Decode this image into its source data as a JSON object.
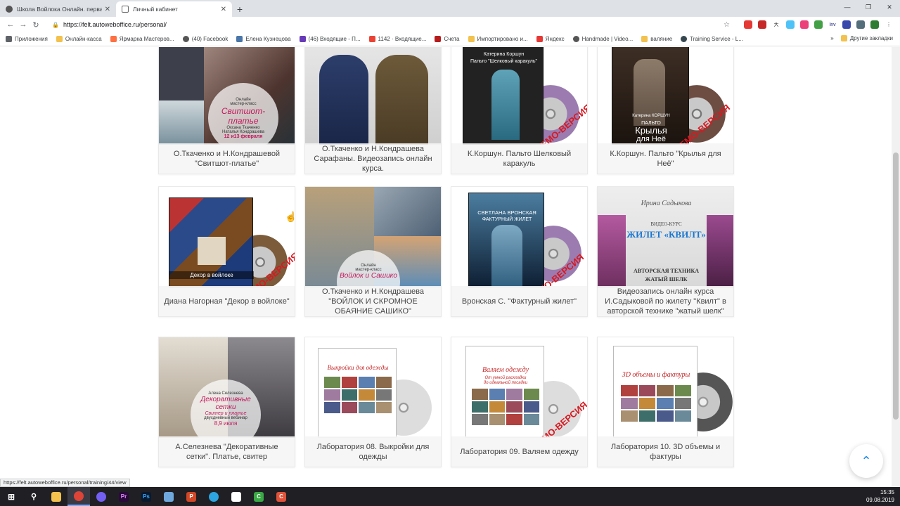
{
  "browser": {
    "tabs": [
      {
        "title": "Школа Войлока Онлайн. первая",
        "active": false
      },
      {
        "title": "Личный кабинет",
        "active": true
      }
    ],
    "url": "https://felt.autoweboffice.ru/personal/",
    "bookmarks": [
      "Приложения",
      "Онлайн-касса",
      "Ярмарка Мастеров...",
      "(40) Facebook",
      "Елена Кузнецова",
      "(46) Входящие - П...",
      "1142 · Входящие...",
      "Счета",
      "Импортировано и...",
      "Яндекс",
      "Handmade | Video...",
      "валяние",
      "Training Service - L..."
    ],
    "other_bookmarks": "Другие закладки"
  },
  "cards": [
    {
      "caption": "О.Ткаченко и Н.Кондрашевой \"Свитшот-платье\"",
      "badge": [
        "Онлайн",
        "мастер-класс",
        "Свитшот-",
        "платье",
        "Оксана Ткаченко",
        "Наталья Кондрашева",
        "12 и13 февраля"
      ]
    },
    {
      "caption": "О.Ткаченко и Н.Кондрашева Сарафаны. Видеозапись онлайн курса."
    },
    {
      "caption": "К.Коршун. Пальто Шелковый каракуль",
      "dvd": [
        "Катерина Коршун",
        "Пальто \"Шелковый каракуль\""
      ],
      "ribbon": "ДЕМО-ВЕРСИЯ"
    },
    {
      "caption": "К.Коршун. Пальто \"Крылья для Неё\"",
      "dvd": [
        "Катерина КОРШУН",
        "ПАЛЬТО",
        "Крылья",
        "для Неё"
      ],
      "ribbon": "ДЕМО-ВЕРСИЯ"
    },
    {
      "caption": "Диана Нагорная \"Декор в войлоке\"",
      "dvd": [
        "Декор в войлоке"
      ],
      "ribbon": "ДЕМО-ВЕРСИЯ"
    },
    {
      "caption": "О.Ткаченко и Н.Кондрашева \"ВОЙЛОК И СКРОМНОЕ ОБАЯНИЕ САШИКО\"",
      "badge": [
        "Онлайн",
        "мастер-класс",
        "Войлок и Сашико"
      ]
    },
    {
      "caption": "Вронская С. \"Фактурный жилет\"",
      "dvd": [
        "СВЕТЛАНА ВРОНСКАЯ",
        "ФАКТУРНЫЙ ЖИЛЕТ"
      ],
      "ribbon": "ДЕМО-ВЕРСИЯ"
    },
    {
      "caption": "Видеозапись онлайн курса И.Садыковой по жилету \"Квилт\" в авторской технике \"жатый шелк\"",
      "poster": [
        "Ирина Садыкова",
        "ВИДЕО-КУРС",
        "ЖИЛЕТ «КВИЛТ»",
        "АВТОРСКАЯ ТЕХНИКА",
        "ЖАТЫЙ ШЕЛК"
      ]
    },
    {
      "caption": "А.Селезнева \"Декоративные сетки\". Платье, свитер",
      "badge": [
        "Алена Селезнева",
        "Декоративные",
        "сетки",
        "Свитер и платье",
        "двухдневный вебинар",
        "8,9 июля"
      ]
    },
    {
      "caption": "Лаборатория 08. Выкройки для одежды",
      "box": [
        "Выкройки для одежды"
      ]
    },
    {
      "caption": "Лаборатория 09. Валяем одежду",
      "box": [
        "Валяем одежду",
        "От умной раскладки",
        "до идеальной посадки"
      ],
      "ribbon": "ДЕМО-ВЕРСИЯ"
    },
    {
      "caption": "Лаборатория 10. 3D объемы и фактуры",
      "box": [
        "3D объемы и фактуры"
      ]
    }
  ],
  "status_link": "https://felt.autoweboffice.ru/personal/training/44/view",
  "clock": {
    "time": "15:35",
    "date": "09.08.2019"
  },
  "colors": {
    "accent": "#1e88e5",
    "ribbon": "#d71920"
  }
}
